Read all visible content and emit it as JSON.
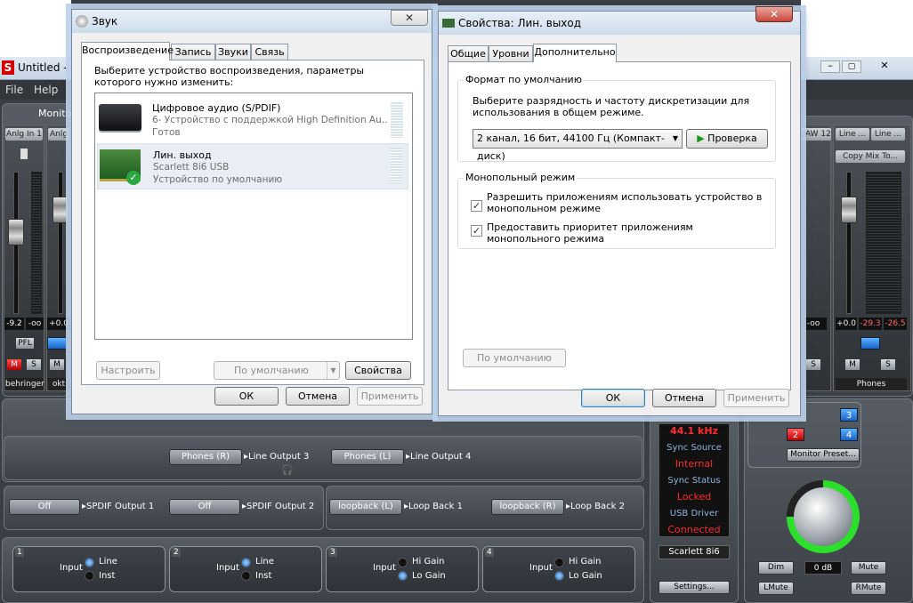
{
  "mixer": {
    "title": "Untitled - S",
    "menu": [
      "File",
      "Help"
    ],
    "section_label": "Monito",
    "left_strips": [
      {
        "label": "Anlg In 1",
        "value_l": "-9.2",
        "value_r": "-oo",
        "name": "behringer"
      },
      {
        "label": "Anlg",
        "value_l": "+0.0",
        "value_r": "",
        "name": "okt"
      }
    ],
    "right_strips": [
      {
        "label": "DAW 12",
        "value": "-oo"
      },
      {
        "label_a": "Line ...",
        "label_b": "Line ...",
        "copy_mix": "Copy Mix To...",
        "value_l": "+0.0",
        "value_r1": "-29.3",
        "value_r2": "-26.5",
        "name": "Phones"
      }
    ],
    "pfl_label": "PFL",
    "mute_label": "M",
    "solo_label": "S",
    "routes_row1": [
      {
        "source": "Phones (R)",
        "target": "Line Output 3"
      },
      {
        "source": "Phones (L)",
        "target": "Line Output 4"
      }
    ],
    "routes_row2": [
      {
        "source": "Off",
        "target": "SPDIF Output 1"
      },
      {
        "source": "Off",
        "target": "SPDIF Output 2"
      },
      {
        "source": "loopback (L)",
        "target": "Loop Back 1"
      },
      {
        "source": "loopback (R)",
        "target": "Loop Back 2"
      }
    ],
    "inputs": [
      {
        "num": "1",
        "label": "Input",
        "opt_a": "Line",
        "opt_b": "Inst",
        "selected": "a"
      },
      {
        "num": "2",
        "label": "Input",
        "opt_a": "Line",
        "opt_b": "Inst",
        "selected": "a"
      },
      {
        "num": "3",
        "label": "Input",
        "opt_a": "Hi Gain",
        "opt_b": "Lo Gain",
        "selected": "b"
      },
      {
        "num": "4",
        "label": "Input",
        "opt_a": "Hi Gain",
        "opt_b": "Lo Gain",
        "selected": "b"
      }
    ],
    "status": {
      "rate": "44.1 kHz",
      "sync_source_label": "Sync Source",
      "sync_source": "Internal",
      "sync_status_label": "Sync Status",
      "sync_status": "Locked",
      "usb_label": "USB Driver",
      "usb": "Connected",
      "device": "Scarlett 8i6",
      "settings": "Settings..."
    },
    "monitor": {
      "btn_2": "2",
      "btn_3": "3",
      "btn_4": "4",
      "preset": "Monitor Preset...",
      "dim": "Dim",
      "db": "0 dB",
      "mute": "Mute",
      "lmute": "LMute",
      "rmute": "RMute"
    },
    "colors": {
      "red": "#ff2a2a",
      "blue": "#2f8cff"
    }
  },
  "sound_dialog": {
    "title": "Звук",
    "tabs": [
      "Воспроизведение",
      "Запись",
      "Звуки",
      "Связь"
    ],
    "instruction": "Выберите устройство воспроизведения, параметры которого нужно изменить:",
    "devices": [
      {
        "name": "Цифровое аудио (S/PDIF)",
        "line2": "6- Устройство с поддержкой High Definition Au...",
        "line3": "Готов",
        "icon": "spdif-device-icon"
      },
      {
        "name": "Лин. выход",
        "line2": "Scarlett 8i6 USB",
        "line3": "Устройство по умолчанию",
        "icon": "soundcard-default-icon"
      }
    ],
    "configure": "Настроить",
    "default": "По умолчанию",
    "properties": "Свойства",
    "ok": "ОК",
    "cancel": "Отмена",
    "apply": "Применить"
  },
  "props_dialog": {
    "title": "Свойства: Лин. выход",
    "tabs": [
      "Общие",
      "Уровни",
      "Дополнительно"
    ],
    "format_group": "Формат по умолчанию",
    "format_desc": "Выберите разрядность и частоту дискретизации для использования в общем режиме.",
    "format_value": "2 канал, 16 бит, 44100 Гц (Компакт-диск)",
    "test": "Проверка",
    "exclusive_group": "Монопольный режим",
    "check1": "Разрешить приложениям использовать устройство в монопольном режиме",
    "check2": "Предоставить приоритет приложениям монопольного режима",
    "restore_default": "По умолчанию",
    "ok": "ОК",
    "cancel": "Отмена",
    "apply": "Применить"
  }
}
